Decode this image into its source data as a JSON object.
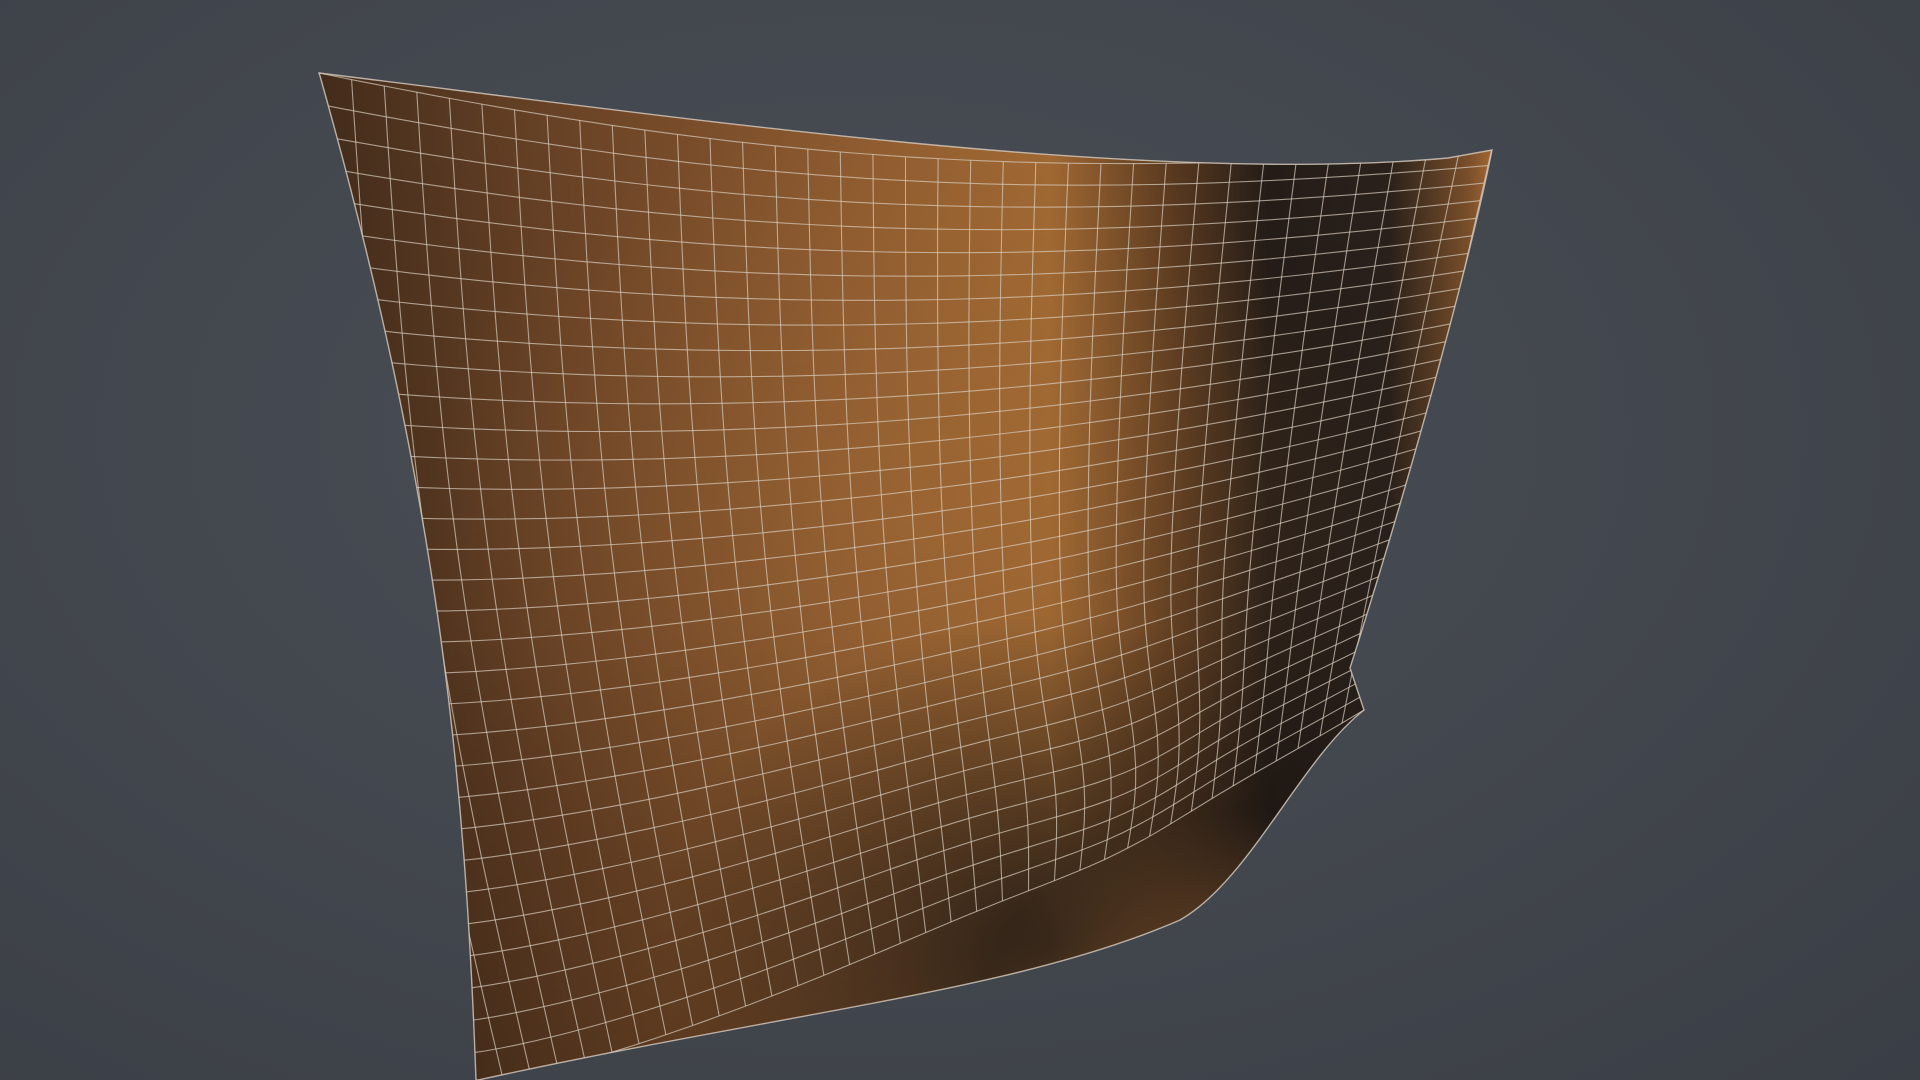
{
  "viewport": {
    "background_color": "#42464d",
    "object": {
      "kind": "cloth-plane-mesh",
      "material_color": "#9a6634",
      "wire_color": "#d8cdbf",
      "grid_columns": 36,
      "grid_rows": 32
    }
  }
}
